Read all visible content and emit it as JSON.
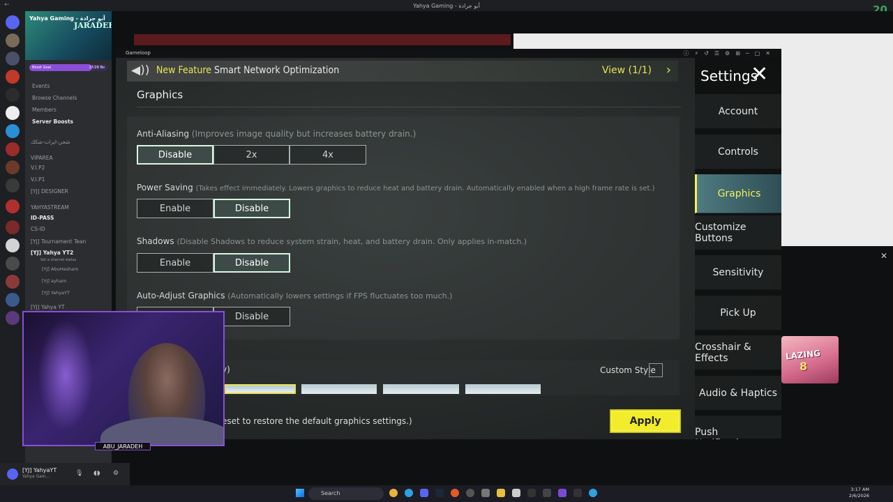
{
  "window_title": "Yahya Gaming - أبو جرادة",
  "top_counter": "20",
  "discord": {
    "server_title": "Yahya Gaming - أبو جرادة",
    "banner_logo": "JARADEH",
    "boost_goal_label": "Boost Goal",
    "boost_goal_value": "17/28 Bo",
    "channels": [
      {
        "label": "Events",
        "bold": false
      },
      {
        "label": "Browse Channels",
        "bold": false
      },
      {
        "label": "Members",
        "bold": false
      },
      {
        "label": "Server Boosts",
        "bold": true
      },
      {
        "label": "شحن-ايرات-شكك",
        "bold": false
      },
      {
        "label": "VIPAREA",
        "bold": false
      },
      {
        "label": "V.I.P2",
        "bold": false
      },
      {
        "label": "V.I.P1",
        "bold": false
      },
      {
        "label": "[YJ] DESIGNER",
        "bold": false
      },
      {
        "label": "YAHYASTREAM",
        "bold": false
      },
      {
        "label": "ID-PASS",
        "bold": true
      },
      {
        "label": "CS-ID",
        "bold": false
      },
      {
        "label": "[YJ] Tournament Tean",
        "bold": false
      },
      {
        "label": "[YJ] Yahya YT2",
        "bold": true
      },
      {
        "label": "Set a channel status",
        "bold": false
      },
      {
        "label": "[YJ] AbuHesham",
        "bold": false
      },
      {
        "label": "[YJ] ayham",
        "bold": false
      },
      {
        "label": "[YJ] YahyaYT",
        "bold": false
      },
      {
        "label": "[YJ] Yahya YT",
        "bold": false
      }
    ],
    "user_name": "[YJ] YahyaYT",
    "user_status": "Yahya Gam..."
  },
  "gameloop": {
    "window_name": "Gameloop",
    "feature_prefix": "New Feature",
    "feature_text": "Smart Network Optimization",
    "view_label": "View (1/1)",
    "section_title": "Graphics",
    "options": [
      {
        "label": "Anti-Aliasing",
        "hint": "(Improves image quality but increases battery drain.)",
        "choices": [
          "Disable",
          "2x",
          "4x"
        ],
        "selected": 0
      },
      {
        "label": "Power Saving",
        "hint": "(Takes effect immediately. Lowers graphics to reduce heat and battery drain. Automatically enabled when a high frame rate is set.)",
        "choices": [
          "Enable",
          "Disable"
        ],
        "selected": 1
      },
      {
        "label": "Shadows",
        "hint": "(Disable Shadows to reduce system strain, heat, and battery drain. Only applies in-match.)",
        "choices": [
          "Enable",
          "Disable"
        ],
        "selected": 1
      },
      {
        "label": "Auto-Adjust Graphics",
        "hint": "(Automatically lowers settings if FPS fluctuates too much.)",
        "choices": [
          "",
          "Disable"
        ],
        "selected": -1
      }
    ],
    "partial_label": "y)",
    "custom_style_label": "Custom Style",
    "reset_text": "eset to restore the default graphics settings.)",
    "apply_label": "Apply",
    "settings_title": "Settings",
    "menu": [
      "Account",
      "Controls",
      "Graphics",
      "Customize Buttons",
      "Sensitivity",
      "Pick Up",
      "Crosshair & Effects",
      "Audio & Haptics",
      "Push Notifications"
    ],
    "menu_selected": 2
  },
  "overlay": {
    "webcam_name": "ABU_JARADEH",
    "ad_line1": "LAZING",
    "ad_line2": "8"
  },
  "taskbar": {
    "search_placeholder": "Search",
    "time": "3:17 AM",
    "date": "2/6/2026"
  }
}
